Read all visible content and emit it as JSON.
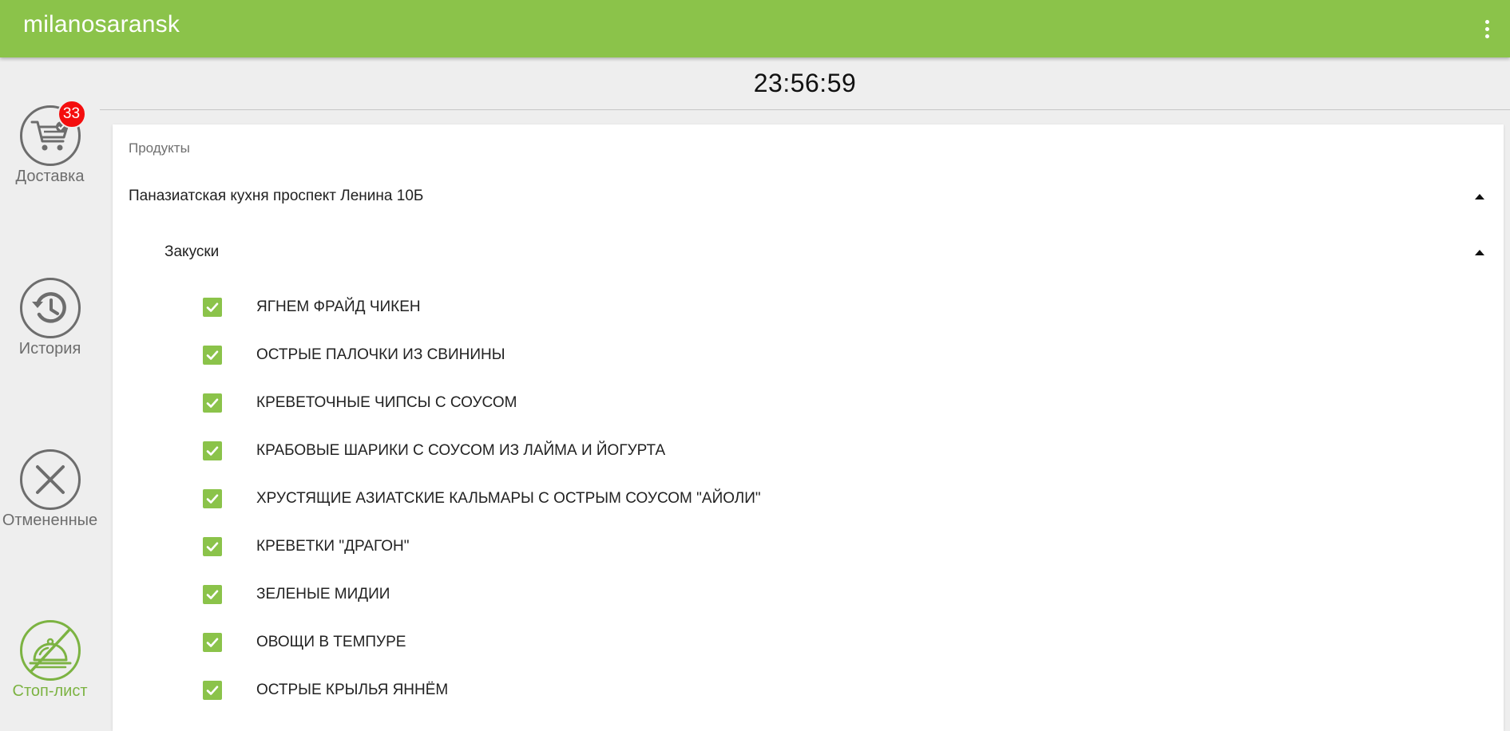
{
  "header": {
    "app_title": "milanosaransk",
    "menu_icon": "more-vert-icon",
    "background_color": "#8bc34a"
  },
  "sidebar": {
    "items": [
      {
        "label": "Доставка",
        "icon": "cart-icon",
        "badge": "33",
        "active": false
      },
      {
        "label": "История",
        "icon": "history-icon",
        "active": false
      },
      {
        "label": "Отмененные",
        "icon": "close-icon",
        "active": false
      },
      {
        "label": "Стоп-лист",
        "icon": "stop-list-icon",
        "active": true
      }
    ]
  },
  "clock": {
    "time": "23:56:59"
  },
  "products": {
    "title": "Продукты",
    "restaurant": {
      "name": "Паназиатская кухня проспект Ленина 10Б",
      "expanded": true
    },
    "category": {
      "name": "Закуски",
      "expanded": true
    },
    "items": [
      {
        "name": "ЯГНЕМ ФРАЙД ЧИКЕН",
        "checked": true
      },
      {
        "name": "ОСТРЫЕ ПАЛОЧКИ ИЗ СВИНИНЫ",
        "checked": true
      },
      {
        "name": "КРЕВЕТОЧНЫЕ ЧИПСЫ С СОУСОМ",
        "checked": true
      },
      {
        "name": "КРАБОВЫЕ ШАРИКИ С СОУСОМ ИЗ ЛАЙМА И ЙОГУРТА",
        "checked": true
      },
      {
        "name": "ХРУСТЯЩИЕ АЗИАТСКИЕ КАЛЬМАРЫ С ОСТРЫМ СОУСОМ \"АЙОЛИ\"",
        "checked": true
      },
      {
        "name": "КРЕВЕТКИ \"ДРАГОН\"",
        "checked": true
      },
      {
        "name": "ЗЕЛЕНЫЕ МИДИИ",
        "checked": true
      },
      {
        "name": "ОВОЩИ В ТЕМПУРЕ",
        "checked": true
      },
      {
        "name": "ОСТРЫЕ КРЫЛЬЯ ЯННЁМ",
        "checked": true
      }
    ]
  }
}
